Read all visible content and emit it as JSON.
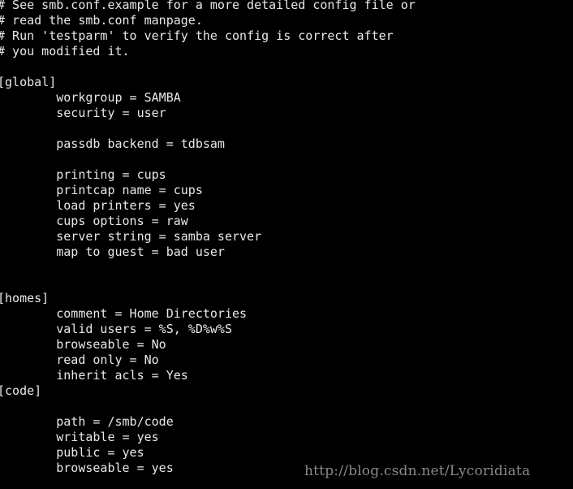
{
  "terminal": {
    "lines": [
      "# See smb.conf.example for a more detailed config file or",
      "# read the smb.conf manpage.",
      "# Run 'testparm' to verify the config is correct after",
      "# you modified it.",
      "",
      "[global]",
      "        workgroup = SAMBA",
      "        security = user",
      "",
      "        passdb backend = tdbsam",
      "",
      "        printing = cups",
      "        printcap name = cups",
      "        load printers = yes",
      "        cups options = raw",
      "        server string = samba server",
      "        map to guest = bad user",
      "",
      "",
      "[homes]",
      "        comment = Home Directories",
      "        valid users = %S, %D%w%S",
      "        browseable = No",
      "        read only = No",
      "        inherit acls = Yes",
      "[code]",
      "",
      "        path = /smb/code",
      "        writable = yes",
      "        public = yes",
      "        browseable = yes"
    ]
  },
  "watermark": "http://blog.csdn.net/Lycoridiata",
  "colors": {
    "background": "#000000",
    "text": "#e8e8e8",
    "watermark": "#8a8a8a"
  }
}
